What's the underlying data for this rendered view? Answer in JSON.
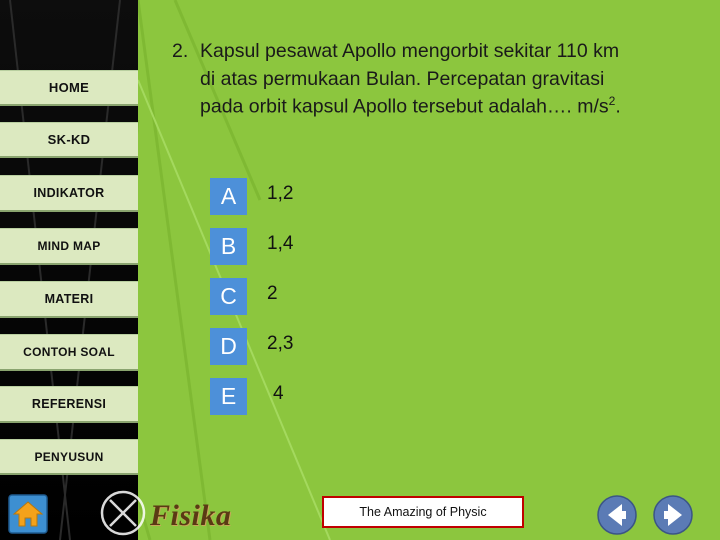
{
  "slide": {
    "background_color": "#8CC63E",
    "accent_color": "#4D90D9",
    "nav_button_color": "#DCE9C0"
  },
  "sidebar": {
    "items": [
      {
        "label": "HOME",
        "name": "home"
      },
      {
        "label": "SK-KD",
        "name": "sk-kd"
      },
      {
        "label": "INDIKATOR",
        "name": "indikator"
      },
      {
        "label": "MIND MAP",
        "name": "mind-map"
      },
      {
        "label": "MATERI",
        "name": "materi"
      },
      {
        "label": "CONTOH SOAL",
        "name": "contoh-soal"
      },
      {
        "label": "REFERENSI",
        "name": "referensi"
      },
      {
        "label": "PENYUSUN",
        "name": "penyusun"
      }
    ]
  },
  "question": {
    "number": "2.",
    "line1": "Kapsul pesawat Apollo mengorbit sekitar 110 km",
    "line2": "di atas permukaan Bulan. Percepatan gravitasi",
    "line3": "pada orbit kapsul Apollo tersebut adalah…. m/s",
    "unit_exponent": "2",
    "line3_end": "."
  },
  "options": [
    {
      "key": "A",
      "value": "1,2"
    },
    {
      "key": "B",
      "value": "1,4"
    },
    {
      "key": "C",
      "value": "2"
    },
    {
      "key": "D",
      "value": "2,3"
    },
    {
      "key": "E",
      "value": "4"
    }
  ],
  "footer": {
    "logo_text": "Fisika",
    "banner_text": "The Amazing of Physic",
    "home_icon": "home-icon",
    "close_icon": "x-circle-icon",
    "prev_icon": "arrow-left-icon",
    "next_icon": "arrow-right-icon"
  }
}
